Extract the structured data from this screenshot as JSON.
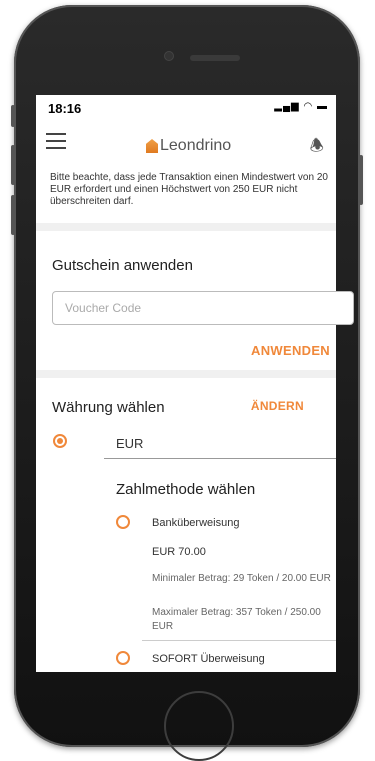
{
  "status": {
    "time": "18:16",
    "icons": "▂▄▆ ◠ ▬"
  },
  "app": {
    "logo_text": "Leondrino"
  },
  "notice": "Bitte beachte, dass jede Transaktion einen Mindestwert von 20 EUR erfordert und einen Höchstwert von 250 EUR nicht überschreiten darf.",
  "voucher": {
    "title": "Gutschein anwenden",
    "placeholder": "Voucher Code",
    "apply_label": "ANWENDEN"
  },
  "currency": {
    "title": "Währung wählen",
    "change_label": "ÄNDERN",
    "selected": "EUR"
  },
  "payment": {
    "title": "Zahlmethode wählen",
    "methods": [
      {
        "name": "Banküberweisung",
        "amount": "EUR 70.00",
        "min": "Minimaler Betrag: 29 Token / 20.00 EUR",
        "max": "Maximaler Betrag: 357 Token / 250.00 EUR"
      },
      {
        "name": "SOFORT Überweisung"
      }
    ]
  },
  "colors": {
    "accent": "#f0883a"
  }
}
